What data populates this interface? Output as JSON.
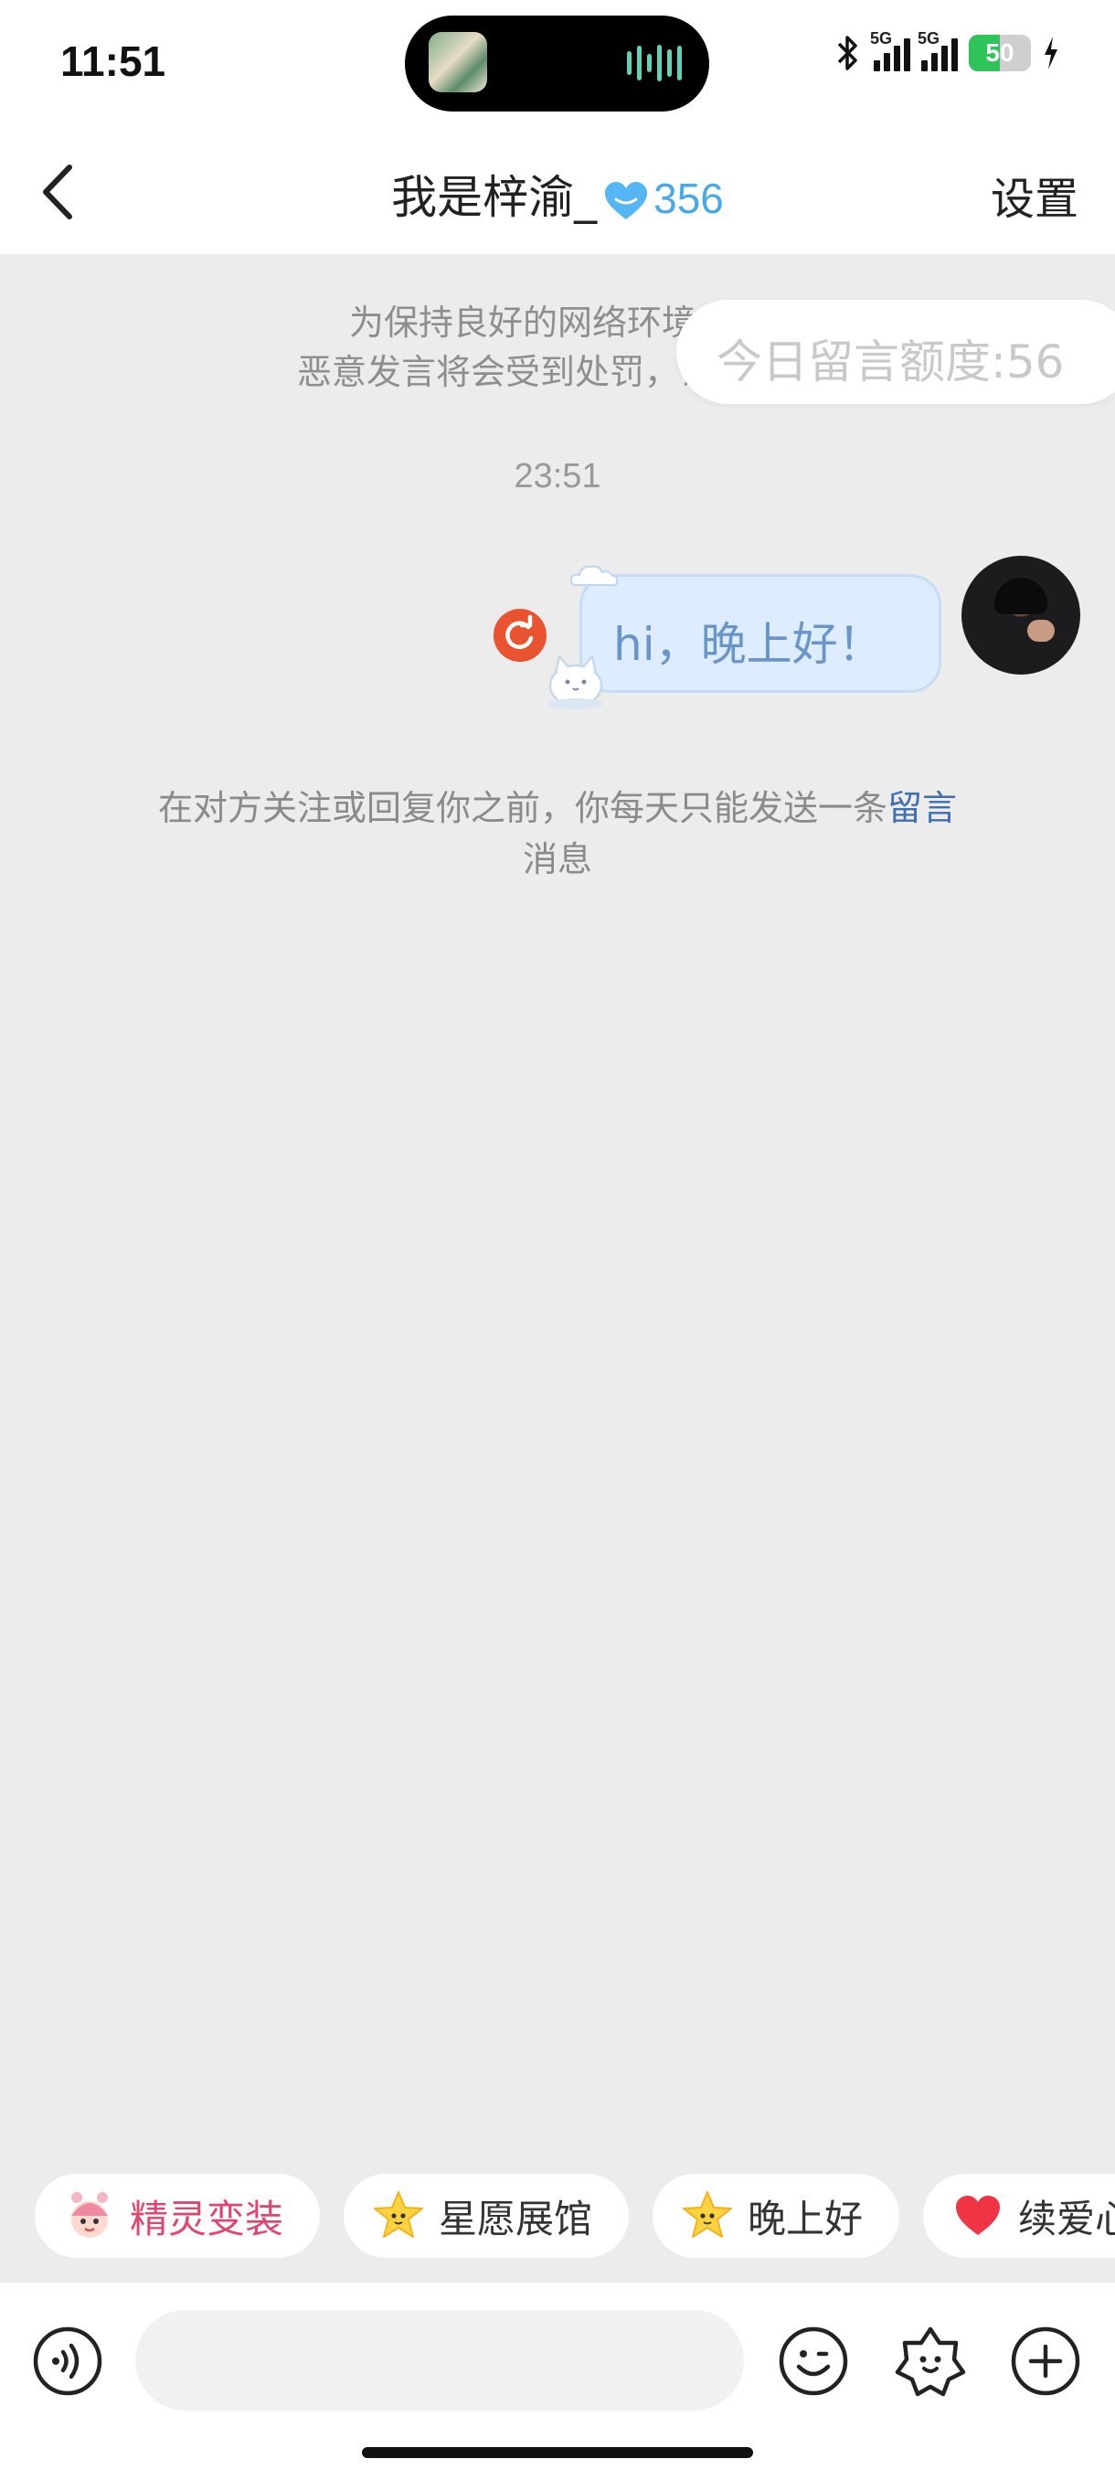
{
  "status_bar": {
    "time": "11:51",
    "network_1": "5G",
    "network_2": "5G",
    "battery_percent": "50",
    "battery_level": 0.5
  },
  "header": {
    "title": "我是梓渝_",
    "score": "356",
    "settings_label": "设置"
  },
  "chat": {
    "notice_line1": "为保持良好的网络环境，请",
    "notice_line2": "恶意发言将会受到处罚，详细细则",
    "quota_label": "今日留言额度:56",
    "timestamp": "23:51",
    "message_text": "hi，晚上好！",
    "hint_text": "在对方关注或回复你之前，你每天只能发送一条",
    "hint_link": "留言",
    "hint_tail": "消息"
  },
  "quick_chips": [
    {
      "label": "精灵变装",
      "icon": "sprite-face-icon"
    },
    {
      "label": "星愿展馆",
      "icon": "star-face-icon"
    },
    {
      "label": "晚上好",
      "icon": "star-face-icon"
    },
    {
      "label": "续爱心",
      "icon": "heart-icon"
    }
  ],
  "input_bar": {
    "placeholder": "",
    "icons": [
      "voice-icon",
      "emoji-icon",
      "sticker-icon",
      "plus-icon"
    ]
  },
  "colors": {
    "accent_blue": "#4aa8e8",
    "link_blue": "#3d6db3",
    "resend_red": "#e9532f",
    "chip_pink": "#e0456e",
    "battery_green": "#2fc45a"
  }
}
